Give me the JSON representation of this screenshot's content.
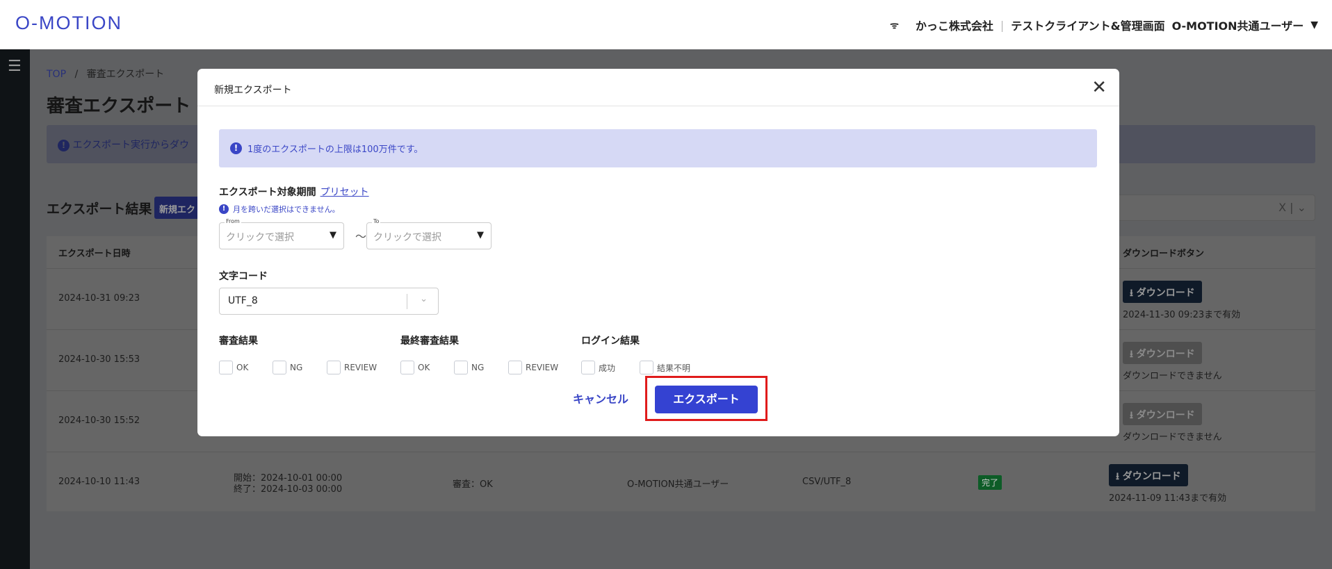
{
  "header": {
    "logo": "O-MOTION",
    "company": "かっこ株式会社",
    "client": "テストクライアント&管理画面",
    "user": "O-MOTION共通ユーザー"
  },
  "breadcrumb": {
    "top": "TOP",
    "sep": "/",
    "current": "審査エクスポート"
  },
  "page": {
    "title": "審査エクスポート",
    "alert": "エクスポート実行からダウ",
    "section_title": "エクスポート結果",
    "new_button": "新規エク",
    "filter_clear": "X | ⌄"
  },
  "table": {
    "headers": {
      "date": "エクスポート日時",
      "download": "ダウンロードボタン"
    },
    "rows": [
      {
        "date": "2024-10-31 09:23",
        "download_label": "ダウンロード",
        "download_enabled": true,
        "note": "2024-11-30 09:23まで有効"
      },
      {
        "date": "2024-10-30 15:53",
        "download_label": "ダウンロード",
        "download_enabled": false,
        "note": "ダウンロードできません"
      },
      {
        "date": "2024-10-30 15:52",
        "download_label": "ダウンロード",
        "download_enabled": false,
        "note": "ダウンロードできません"
      },
      {
        "date": "2024-10-10 11:43",
        "period_start": "開始：2024-10-01 00:00",
        "period_end": "終了：2024-10-03 00:00",
        "condition": "審査：OK",
        "user": "O-MOTION共通ユーザー",
        "format": "CSV/UTF_8",
        "status": "完了",
        "download_label": "ダウンロード",
        "download_enabled": true,
        "note": "2024-11-09 11:43まで有効"
      }
    ]
  },
  "modal": {
    "title": "新規エクスポート",
    "info": "1度のエクスポートの上限は100万件です。",
    "period_label": "エクスポート対象期間",
    "preset_link": "プリセット",
    "period_note": "月を跨いだ選択はできません。",
    "from_legend": "From",
    "to_legend": "To",
    "from_placeholder": "クリックで選択",
    "to_placeholder": "クリックで選択",
    "tilde": "〜",
    "encoding_label": "文字コード",
    "encoding_value": "UTF_8",
    "groups": [
      {
        "label": "審査結果",
        "options": [
          "OK",
          "NG",
          "REVIEW"
        ]
      },
      {
        "label": "最終審査結果",
        "options": [
          "OK",
          "NG",
          "REVIEW"
        ]
      },
      {
        "label": "ログイン結果",
        "options": [
          "成功",
          "結果不明"
        ]
      }
    ],
    "cancel": "キャンセル",
    "export": "エクスポート"
  },
  "colors": {
    "accent": "#3a46c6",
    "highlight": "#e01b1b",
    "success": "#1b8a3d",
    "navy": "#15253b"
  }
}
